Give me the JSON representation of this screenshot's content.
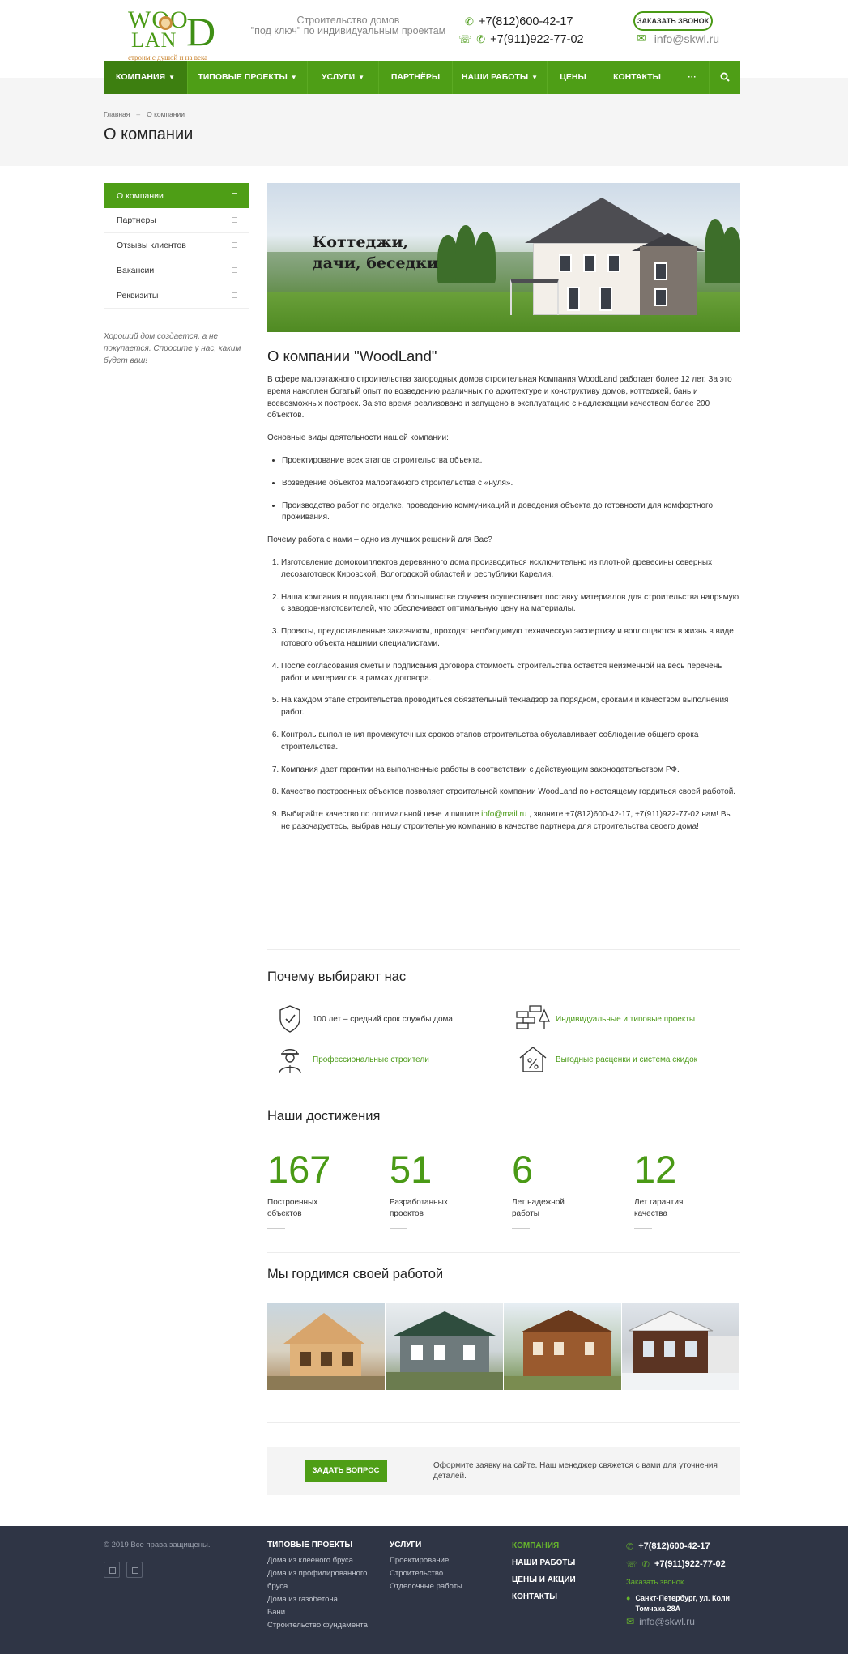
{
  "header": {
    "logo": {
      "line1": "WOO",
      "line2": "LAN",
      "d": "D",
      "slogan": "строим с душой и на века"
    },
    "tagline_1": "Строительство домов",
    "tagline_2": "\"под ключ\" по индивидуальным проектам",
    "phone_1": "+7(812)600-42-17",
    "phone_2": "+7(911)922-77-02",
    "callback_label": "ЗАКАЗАТЬ ЗВОНОК",
    "email": "info@skwl.ru"
  },
  "nav": {
    "items": [
      {
        "label": "КОМПАНИЯ",
        "dropdown": true,
        "active": true
      },
      {
        "label": "ТИПОВЫЕ ПРОЕКТЫ",
        "dropdown": true
      },
      {
        "label": "УСЛУГИ",
        "dropdown": true
      },
      {
        "label": "ПАРТНЁРЫ"
      },
      {
        "label": "НАШИ РАБОТЫ",
        "dropdown": true
      },
      {
        "label": "ЦЕНЫ"
      },
      {
        "label": "КОНТАКТЫ"
      },
      {
        "label": "···"
      }
    ],
    "search_icon": "search-icon"
  },
  "breadcrumb": {
    "home": "Главная",
    "sep": "–",
    "current": "О компании"
  },
  "page_title": "О компании",
  "sidebar": {
    "items": [
      {
        "label": "О компании",
        "active": true
      },
      {
        "label": "Партнеры"
      },
      {
        "label": "Отзывы клиентов"
      },
      {
        "label": "Вакансии"
      },
      {
        "label": "Реквизиты"
      }
    ],
    "quote": "Хороший дом создается, а не покупается. Спросите у нас, каким будет ваш!"
  },
  "banner": {
    "line1": "Коттеджи,",
    "line2": "дачи, беседки"
  },
  "content": {
    "heading": "О компании \"WoodLand\"",
    "intro": "В сфере малоэтажного строительства загородных домов строительная Компания WoodLand работает более 12 лет. За это время накоплен богатый опыт по возведению различных по архитектуре и конструктиву домов, коттеджей, бань и всевозможных построек. За это время реализовано и запущено в эксплуатацию с надлежащим качеством более 200 объектов.",
    "activities_title": "Основные виды деятельности нашей компании:",
    "activities": [
      "Проектирование всех этапов строительства объекта.",
      "Возведение объектов малоэтажного строительства с «нуля».",
      "Производство работ по отделке, проведению коммуникаций и доведения объекта до готовности для комфортного проживания."
    ],
    "why_title": "Почему работа с нами – одно из лучших решений для Вас?",
    "reasons": [
      "Изготовление домокомплектов деревянного дома производиться исключительно из плотной древесины северных лесозаготовок Кировской, Вологодской областей и республики Карелия.",
      "Наша компания в подавляющем большинстве случаев осуществляет поставку материалов для строительства напрямую с заводов-изготовителей, что обеспечивает оптимальную цену на материалы.",
      "Проекты, предоставленные заказчиком, проходят необходимую техническую экспертизу и воплощаются в жизнь в виде готового объекта нашими специалистами.",
      "После согласования сметы и подписания договора стоимость строительства остается неизменной на весь перечень работ и материалов в рамках договора.",
      "На каждом этапе строительства проводиться обязательный технадзор за порядком, сроками и качеством выполнения работ.",
      "Контроль выполнения промежуточных сроков этапов строительства обуславливает соблюдение общего срока строительства.",
      "Компания дает гарантии на выполненные работы в соответствии с действующим законодательством РФ.",
      "Качество построенных объектов позволяет строительной компании WoodLand по настоящему гордиться своей работой."
    ],
    "last_reason_before": "Выбирайте качество по оптимальной цене и пишите ",
    "last_reason_email": "info@mail.ru",
    "last_reason_after": " , звоните +7(812)600-42-17, +7(911)922-77-02 нам! Вы не разочаруетесь, выбрав нашу строительную компанию в качестве партнера для строительства своего дома!"
  },
  "why_us": {
    "title": "Почему выбирают нас",
    "features": [
      {
        "text": "100 лет – средний срок службы дома",
        "icon": "shield-check-icon",
        "green": false
      },
      {
        "text": "Индивидуальные и типовые проекты",
        "icon": "bricks-tree-icon",
        "green": true
      },
      {
        "text": "Профессиональные строители",
        "icon": "builder-icon",
        "green": true
      },
      {
        "text": "Выгодные расценки и система скидок",
        "icon": "house-percent-icon",
        "green": true
      }
    ]
  },
  "achievements": {
    "title": "Наши достижения",
    "items": [
      {
        "value": "167",
        "label_1": "Построенных",
        "label_2": "объектов"
      },
      {
        "value": "51",
        "label_1": "Разработанных",
        "label_2": "проектов"
      },
      {
        "value": "6",
        "label_1": "Лет надежной",
        "label_2": "работы"
      },
      {
        "value": "12",
        "label_1": "Лет гарантия",
        "label_2": "качества"
      }
    ]
  },
  "gallery": {
    "title": "Мы гордимся своей работой"
  },
  "cta": {
    "button": "ЗАДАТЬ ВОПРОС",
    "text": "Оформите заявку на сайте. Наш менеджер свяжется с вами для уточнения деталей."
  },
  "footer": {
    "copyright": "© 2019 Все права защищены.",
    "col1": {
      "title": "ТИПОВЫЕ ПРОЕКТЫ",
      "links": [
        "Дома из клееного бруса",
        "Дома из профилированного",
        "бруса",
        "Дома из газобетона",
        "Бани",
        "Строительство фундамента"
      ]
    },
    "col2": {
      "title": "УСЛУГИ",
      "links": [
        "Проектирование",
        "Строительство",
        "Отделочные работы"
      ]
    },
    "col3": {
      "links": [
        "КОМПАНИЯ",
        "НАШИ РАБОТЫ",
        "ЦЕНЫ И АКЦИИ",
        "КОНТАКТЫ"
      ]
    },
    "contacts": {
      "phone_1": "+7(812)600-42-17",
      "phone_2": "+7(911)922-77-02",
      "callback": "Заказать звонок",
      "address_1": "Санкт-Петербург, ул. Коли",
      "address_2": "Томчака 28А",
      "email": "info@skwl.ru"
    }
  },
  "colors": {
    "accent": "#4e9e16",
    "accent_dark": "#3d7f10",
    "footer_bg": "#2f3545"
  }
}
